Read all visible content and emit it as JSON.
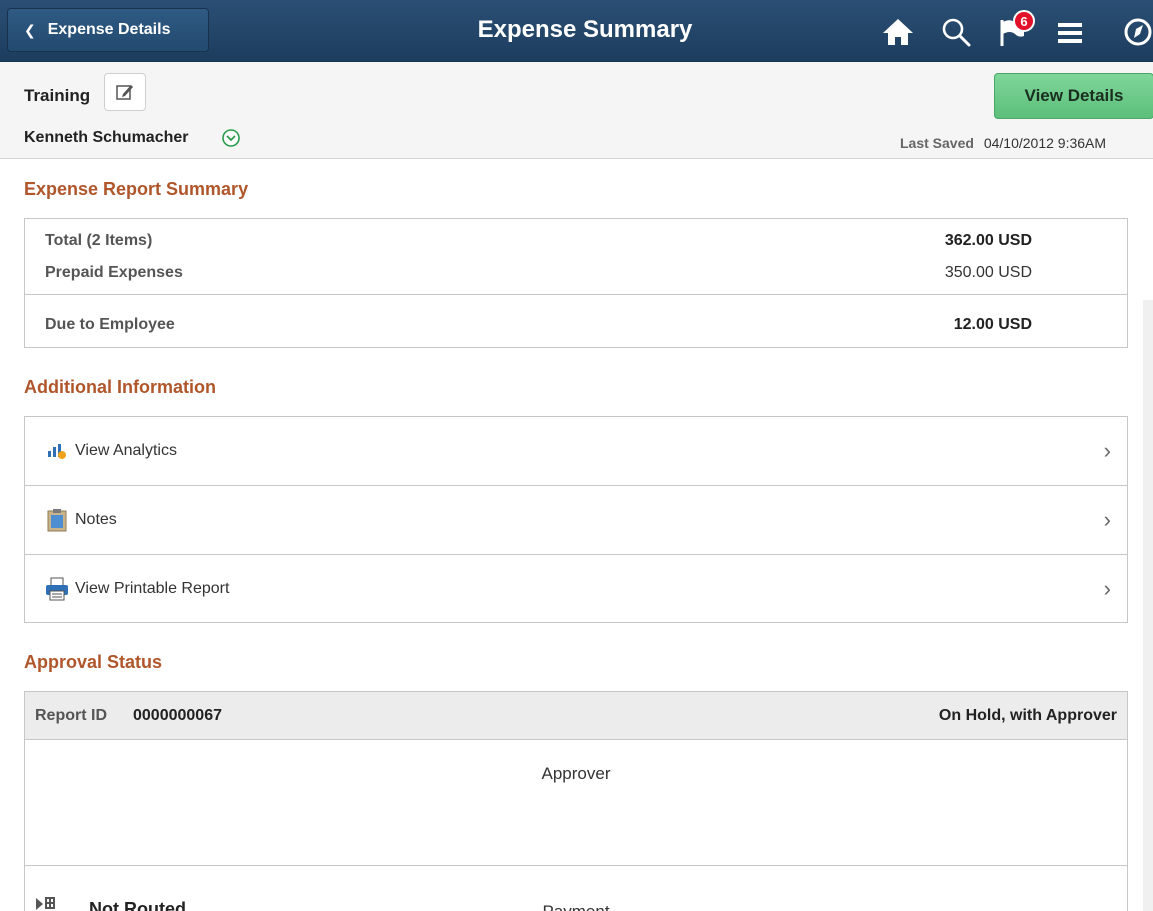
{
  "header": {
    "back_label": "Expense Details",
    "title": "Expense Summary",
    "notification_count": "6",
    "icons": [
      "home-icon",
      "search-icon",
      "notification-flag-icon",
      "menu-icon",
      "navbar-compass-icon"
    ],
    "colors": {
      "bar": "#1d3d5e",
      "badge": "#e3102a"
    }
  },
  "report": {
    "name": "Training",
    "employee": "Kenneth Schumacher",
    "view_details_label": "View Details",
    "last_saved_label": "Last Saved",
    "last_saved_value": "04/10/2012  9:36AM"
  },
  "summary": {
    "title": "Expense Report Summary",
    "rows": [
      {
        "label": "Total (2 Items)",
        "value": "362.00 USD"
      },
      {
        "label": "Prepaid Expenses",
        "value": "350.00 USD"
      },
      {
        "label": "Due to Employee",
        "value": "12.00 USD"
      }
    ]
  },
  "additional": {
    "title": "Additional Information",
    "items": [
      {
        "label": "View Analytics",
        "icon": "analytics-icon"
      },
      {
        "label": "Notes",
        "icon": "notes-icon"
      },
      {
        "label": "View Printable Report",
        "icon": "printer-icon"
      }
    ]
  },
  "approval": {
    "title": "Approval Status",
    "report_id_label": "Report ID",
    "report_id_value": "0000000067",
    "status": "On Hold, with Approver",
    "approver_label": "Approver",
    "not_routed_label": "Not Routed",
    "payment_label": "Payment"
  },
  "colors": {
    "section_title": "#b0562b",
    "primary_button": "#5cbf7a"
  }
}
